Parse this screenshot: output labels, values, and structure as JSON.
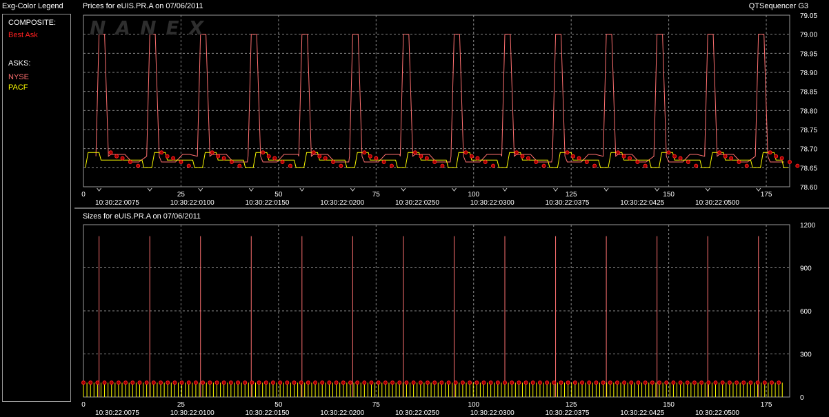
{
  "legend": {
    "header": "Exg-Color Legend",
    "composite_label": "COMPOSITE:",
    "composite_item": "Best Ask",
    "asks_label": "ASKS:",
    "asks_items": [
      "NYSE",
      "PACF"
    ]
  },
  "app_name": "QTSequencer G3",
  "watermark": "NANEX",
  "colors": {
    "best_ask": "#ff2020",
    "nyse": "#ff7070",
    "pacf": "#ffff00",
    "grid": "#8a8a8a",
    "axis_text": "#ffffff"
  },
  "chart_data": [
    {
      "type": "line",
      "title": "Prices for  eUIS.PR.A  on  07/06/2011",
      "ylim": [
        78.6,
        79.05
      ],
      "y_ticks": [
        "79.05",
        "79.00",
        "78.95",
        "78.90",
        "78.85",
        "78.80",
        "78.75",
        "78.70",
        "78.65",
        "78.60"
      ],
      "x_ticks": [
        "0",
        "25",
        "50",
        "75",
        "100",
        "125",
        "150",
        "175"
      ],
      "time_labels": [
        "10:30:22:0075",
        "10:30:22:0100",
        "10:30:22:0150",
        "10:30:22:0200",
        "10:30:22:0250",
        "10:30:22:0300",
        "10:30:22:0375",
        "10:30:22:0425",
        "10:30:22:0500"
      ],
      "xlim": [
        0,
        181
      ],
      "grid": true,
      "series": [
        {
          "name": "NYSE",
          "spike_x": [
            4,
            17,
            30,
            43,
            56,
            69,
            82,
            95,
            108,
            121,
            134,
            147,
            160,
            173
          ],
          "high": 79.0,
          "base": 78.68
        },
        {
          "name": "PACF",
          "cycle_start_x": [
            0,
            17,
            30,
            43,
            56,
            69,
            82,
            95,
            108,
            121,
            134,
            147,
            160,
            173
          ],
          "high": 78.69,
          "low": 78.65
        }
      ]
    },
    {
      "type": "bar",
      "title": "Sizes for  eUIS.PR.A  on  07/06/2011",
      "ylim": [
        0,
        1200
      ],
      "y_ticks": [
        "1200",
        "900",
        "600",
        "300",
        "0"
      ],
      "x_ticks": [
        "0",
        "25",
        "50",
        "75",
        "100",
        "125",
        "150",
        "175"
      ],
      "time_labels": [
        "10:30:22:0075",
        "10:30:22:0100",
        "10:30:22:0150",
        "10:30:22:0200",
        "10:30:22:0250",
        "10:30:22:0300",
        "10:30:22:0375",
        "10:30:22:0425",
        "10:30:22:0500"
      ],
      "xlim": [
        0,
        181
      ],
      "grid": true,
      "spike_x": [
        4,
        17,
        30,
        43,
        56,
        69,
        82,
        95,
        108,
        121,
        134,
        147,
        160,
        173
      ],
      "spike_value": 1120,
      "base_value": 100
    }
  ]
}
